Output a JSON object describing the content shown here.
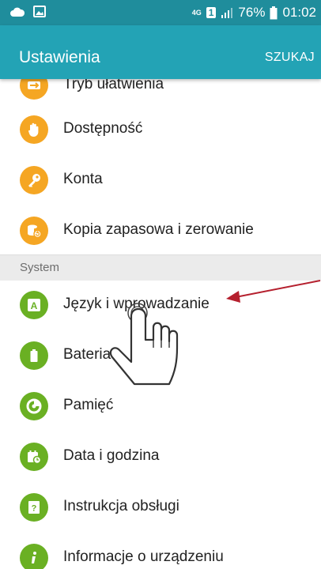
{
  "status_bar": {
    "network": "4G",
    "sim": "1",
    "battery": "76%",
    "time": "01:02"
  },
  "app_bar": {
    "title": "Ustawienia",
    "search_label": "SZUKAJ"
  },
  "items_top": [
    {
      "label": "Tryb ułatwienia",
      "icon": "easy-mode-icon",
      "color": "#f5a623"
    },
    {
      "label": "Dostępność",
      "icon": "hand-icon",
      "color": "#f5a623"
    },
    {
      "label": "Konta",
      "icon": "key-icon",
      "color": "#f5a623"
    },
    {
      "label": "Kopia zapasowa i zerowanie",
      "icon": "backup-icon",
      "color": "#f5a623"
    }
  ],
  "section_header": "System",
  "items_system": [
    {
      "label": "Język i wprowadzanie",
      "icon": "language-icon",
      "color": "#6ab023"
    },
    {
      "label": "Bateria",
      "icon": "battery-icon",
      "color": "#6ab023"
    },
    {
      "label": "Pamięć",
      "icon": "storage-icon",
      "color": "#6ab023"
    },
    {
      "label": "Data i godzina",
      "icon": "calendar-clock-icon",
      "color": "#6ab023"
    },
    {
      "label": "Instrukcja obsługi",
      "icon": "manual-icon",
      "color": "#6ab023"
    },
    {
      "label": "Informacje o urządzeniu",
      "icon": "info-icon",
      "color": "#6ab023"
    }
  ],
  "colors": {
    "status_bar": "#1f8d9c",
    "app_bar": "#23a3b5",
    "arrow": "#b5202e"
  }
}
